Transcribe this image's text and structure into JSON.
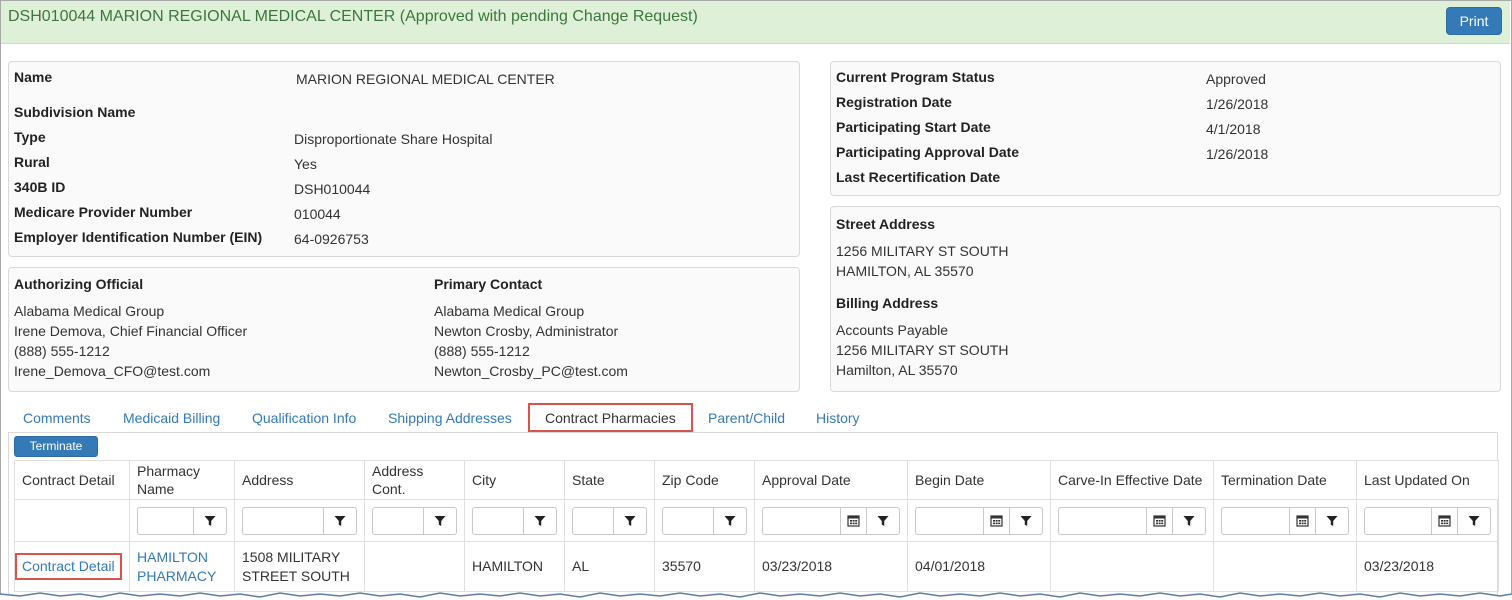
{
  "header": {
    "title": "DSH010044 MARION REGIONAL MEDICAL CENTER (Approved with pending Change Request)",
    "print_label": "Print"
  },
  "entity": {
    "name_label": "Name",
    "name_value": "MARION REGIONAL MEDICAL CENTER",
    "subdivision_label": "Subdivision Name",
    "type_label": "Type",
    "type_value": "Disproportionate Share Hospital",
    "rural_label": "Rural",
    "rural_value": "Yes",
    "id_label": "340B ID",
    "id_value": "DSH010044",
    "medicare_label": "Medicare Provider Number",
    "medicare_value": "010044",
    "ein_label": "Employer Identification Number (EIN)",
    "ein_value": "64-0926753"
  },
  "status": {
    "program_status_label": "Current Program Status",
    "program_status_value": "Approved",
    "registration_label": "Registration Date",
    "registration_value": "1/26/2018",
    "start_label": "Participating Start Date",
    "start_value": "4/1/2018",
    "approval_label": "Participating Approval Date",
    "approval_value": "1/26/2018",
    "recert_label": "Last Recertification Date"
  },
  "contacts": {
    "ao_label": "Authorizing Official",
    "ao_lines": [
      "Alabama Medical Group",
      "Irene Demova, Chief Financial Officer",
      "(888) 555-1212",
      "Irene_Demova_CFO@test.com"
    ],
    "pc_label": "Primary Contact",
    "pc_lines": [
      "Alabama Medical Group",
      "Newton Crosby, Administrator",
      "(888) 555-1212",
      "Newton_Crosby_PC@test.com"
    ]
  },
  "addresses": {
    "street_label": "Street Address",
    "street_lines": [
      "1256 MILITARY ST SOUTH",
      "HAMILTON, AL 35570"
    ],
    "billing_label": "Billing Address",
    "billing_lines": [
      "Accounts Payable",
      "1256 MILITARY ST SOUTH",
      "Hamilton, AL 35570"
    ]
  },
  "tabs": [
    "Comments",
    "Medicaid Billing",
    "Qualification Info",
    "Shipping Addresses",
    "Contract Pharmacies",
    "Parent/Child",
    "History"
  ],
  "active_tab": "Contract Pharmacies",
  "grid": {
    "terminate_label": "Terminate",
    "columns": [
      "Contract Detail",
      "Pharmacy Name",
      "Address",
      "Address Cont.",
      "City",
      "State",
      "Zip Code",
      "Approval Date",
      "Begin Date",
      "Carve-In Effective Date",
      "Termination Date",
      "Last Updated On"
    ],
    "rows": [
      {
        "contract_detail": "Contract Detail",
        "pharmacy_name": "HAMILTON PHARMACY",
        "address": "1508 MILITARY STREET SOUTH",
        "address_cont": "",
        "city": "HAMILTON",
        "state": "AL",
        "zip": "35570",
        "approval_date": "03/23/2018",
        "begin_date": "04/01/2018",
        "carve_in_date": "",
        "termination_date": "",
        "last_updated": "03/23/2018"
      }
    ]
  },
  "colors": {
    "accent": "#337ab7",
    "header_bg": "#dff0d8",
    "header_text": "#3c763d",
    "highlight": "#d9534f"
  }
}
